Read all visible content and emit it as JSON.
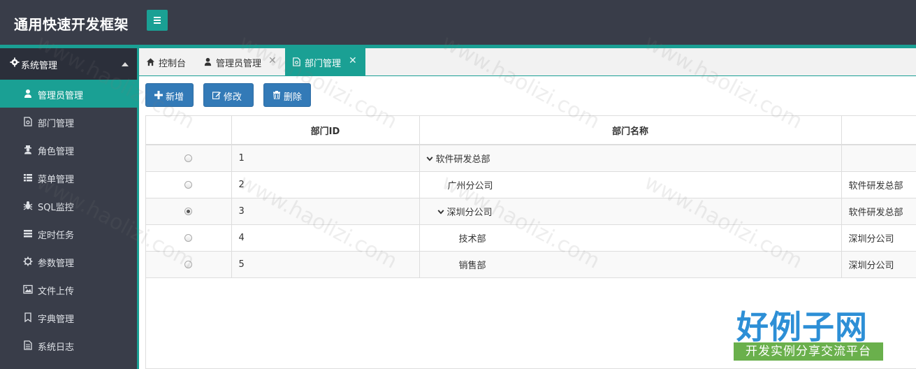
{
  "app": {
    "title": "通用快速开发框架"
  },
  "sidebar": {
    "section_label": "系统管理",
    "items": [
      {
        "label": "管理员管理",
        "icon": "user-icon",
        "active": true
      },
      {
        "label": "部门管理",
        "icon": "file-icon",
        "active": false
      },
      {
        "label": "角色管理",
        "icon": "user-secret-icon",
        "active": false
      },
      {
        "label": "菜单管理",
        "icon": "list-icon",
        "active": false
      },
      {
        "label": "SQL监控",
        "icon": "bug-icon",
        "active": false
      },
      {
        "label": "定时任务",
        "icon": "tasks-icon",
        "active": false
      },
      {
        "label": "参数管理",
        "icon": "cog-icon",
        "active": false
      },
      {
        "label": "文件上传",
        "icon": "image-icon",
        "active": false
      },
      {
        "label": "字典管理",
        "icon": "bookmark-icon",
        "active": false
      },
      {
        "label": "系统日志",
        "icon": "file-text-icon",
        "active": false
      }
    ]
  },
  "tabs": [
    {
      "label": "控制台",
      "icon": "home-icon",
      "closable": false,
      "active": false
    },
    {
      "label": "管理员管理",
      "icon": "user-icon",
      "closable": true,
      "active": false
    },
    {
      "label": "部门管理",
      "icon": "file-icon",
      "closable": true,
      "active": true
    }
  ],
  "toolbar": {
    "add_label": "新增",
    "edit_label": "修改",
    "delete_label": "删除"
  },
  "table": {
    "headers": [
      "",
      "部门ID",
      "部门名称",
      ""
    ],
    "rows": [
      {
        "id": "1",
        "name": "软件研发总部",
        "parent": "",
        "expandable": true,
        "selected": false
      },
      {
        "id": "2",
        "name": "广州分公司",
        "parent": "软件研发总部",
        "expandable": false,
        "selected": false
      },
      {
        "id": "3",
        "name": "深圳分公司",
        "parent": "软件研发总部",
        "expandable": true,
        "selected": true
      },
      {
        "id": "4",
        "name": "技术部",
        "parent": "深圳分公司",
        "expandable": false,
        "selected": false
      },
      {
        "id": "5",
        "name": "销售部",
        "parent": "深圳分公司",
        "expandable": false,
        "selected": false
      }
    ]
  },
  "watermark": {
    "text": "www.haolizi.com",
    "logo_big": "好例子网",
    "logo_small": "开发实例分享交流平台"
  },
  "colors": {
    "header_bg": "#393d49",
    "accent": "#1aa094",
    "button": "#337ab7"
  }
}
